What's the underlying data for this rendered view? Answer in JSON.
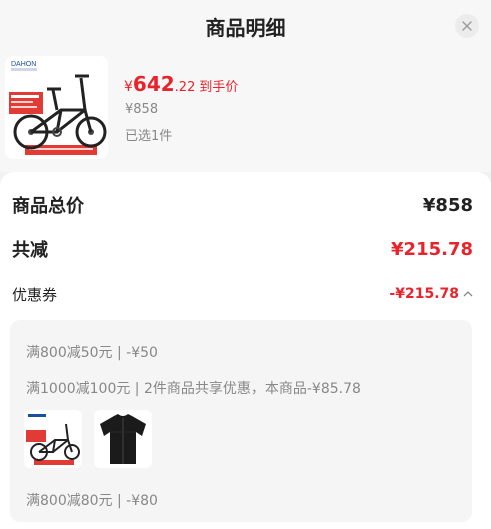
{
  "header": {
    "title": "商品明细"
  },
  "product": {
    "brand_text": "DAHON",
    "price_symbol": "¥",
    "price_int": "642",
    "price_dec": ".22",
    "price_tag": "到手价",
    "original_price": "¥858",
    "selected_qty": "已选1件"
  },
  "summary": {
    "total_label": "商品总价",
    "total_value": "¥858",
    "reduce_label": "共减",
    "reduce_value": "¥215.78",
    "coupon_label": "优惠券",
    "coupon_value": "-¥215.78"
  },
  "coupons": [
    {
      "text": "满800减50元 | -¥50"
    },
    {
      "text": "满1000减100元 | 2件商品共享优惠，本商品-¥85.78"
    },
    {
      "text": "满800减80元 | -¥80"
    }
  ],
  "colors": {
    "accent_red": "#e8232b",
    "muted": "#888888"
  },
  "icons": {
    "close": "close-icon",
    "collapse": "chevron-up-icon"
  }
}
